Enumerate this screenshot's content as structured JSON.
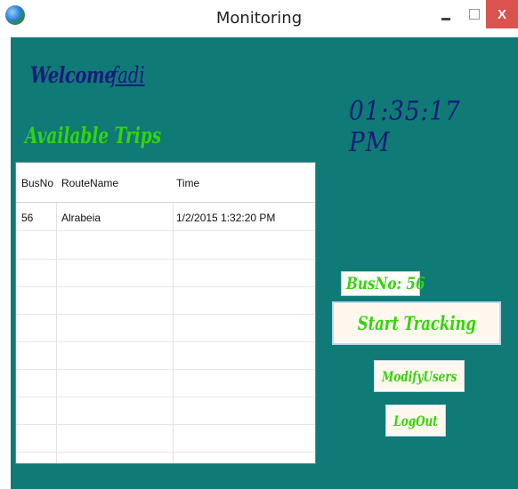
{
  "window": {
    "title": "Monitoring",
    "close_label": "X"
  },
  "header": {
    "welcome_label": "Welcome",
    "username": "fadi",
    "clock": "01:35:17 PM"
  },
  "trips": {
    "title": "Available Trips",
    "columns": [
      "BusNo",
      "RouteName",
      "Time"
    ],
    "rows": [
      {
        "busno": "56",
        "route": "Alrabeia",
        "time": "1/2/2015 1:32:20 PM"
      }
    ]
  },
  "status": {
    "busno_text": "BusNo: 56"
  },
  "actions": {
    "start_tracking": "Start Tracking",
    "modify_users": "ModifyUsers",
    "logout": "LogOut"
  },
  "colors": {
    "background": "#0f7a76",
    "accent_green": "#35d40a",
    "navy_text": "#1a1a7a",
    "close_red": "#d9534f"
  }
}
